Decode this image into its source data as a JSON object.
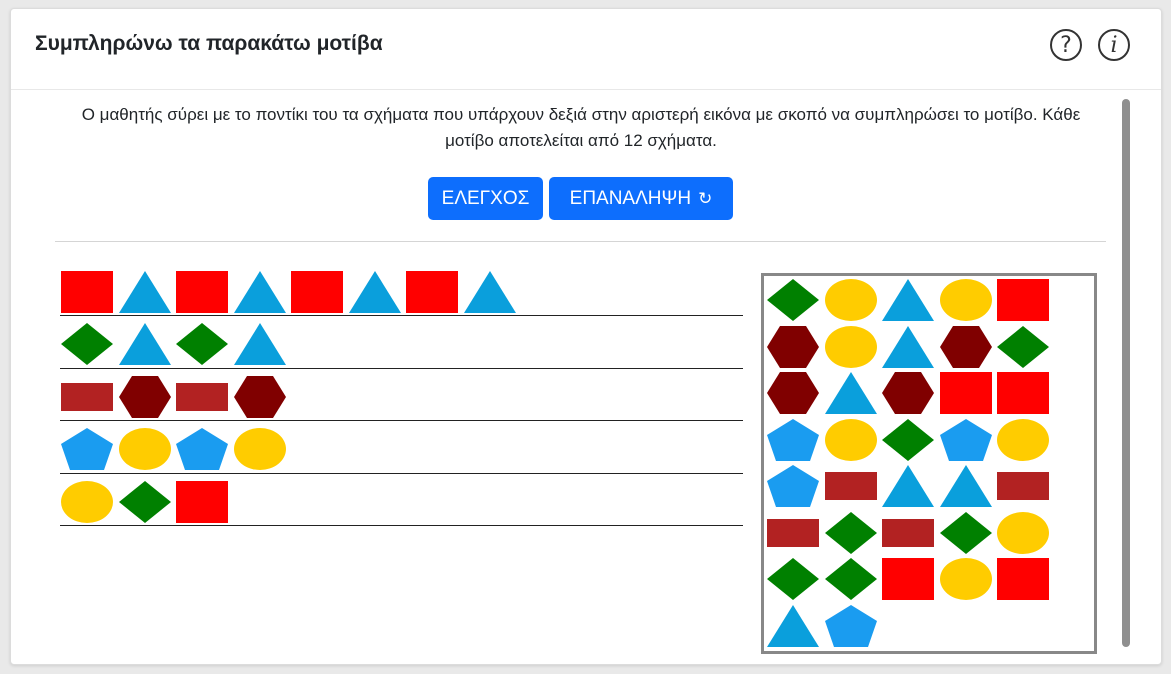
{
  "header": {
    "title": "Συμπληρώνω τα παρακάτω μοτίβα",
    "help_label": "?",
    "info_label": "i"
  },
  "instructions": "Ο μαθητής σύρει με το ποντίκι του τα σχήματα που υπάρχουν δεξιά στην αριστερή εικόνα με σκοπό να συμπληρώσει το μοτίβο. Κάθε μοτίβο αποτελείται από 12 σχήματα.",
  "buttons": {
    "check_label": "ΕΛΕΓΧΟΣ",
    "reset_label": "ΕΠΑΝΑΛΗΨΗ",
    "reset_icon": "↻"
  },
  "colors": {
    "red": "#ff0000",
    "blue": "#0a9fdc",
    "bright_blue": "#1a9cf0",
    "green": "#008000",
    "darkred": "#b22222",
    "maroon": "#800000",
    "yellow": "#ffcc00",
    "button": "#0d6efd"
  },
  "patterns": [
    [
      "square",
      "triangle",
      "square",
      "triangle",
      "square",
      "triangle",
      "square",
      "triangle"
    ],
    [
      "diamond",
      "triangle",
      "diamond",
      "triangle"
    ],
    [
      "rect",
      "hexagon",
      "rect",
      "hexagon"
    ],
    [
      "pentagon",
      "ellipse",
      "pentagon",
      "ellipse"
    ],
    [
      "ellipse",
      "diamond",
      "square"
    ]
  ],
  "palette": [
    [
      "diamond",
      "ellipse",
      "triangle",
      "ellipse",
      "square"
    ],
    [
      "hexagon",
      "ellipse",
      "triangle",
      "hexagon",
      "diamond"
    ],
    [
      "hexagon",
      "triangle",
      "hexagon",
      "square",
      "square"
    ],
    [
      "pentagon",
      "ellipse",
      "diamond",
      "pentagon",
      "ellipse"
    ],
    [
      "pentagon",
      "rect",
      "triangle",
      "triangle",
      "rect"
    ],
    [
      "rect",
      "diamond",
      "rect",
      "diamond",
      "ellipse"
    ],
    [
      "diamond",
      "diamond",
      "square",
      "ellipse",
      "square"
    ],
    [
      "triangle",
      "pentagon"
    ]
  ]
}
